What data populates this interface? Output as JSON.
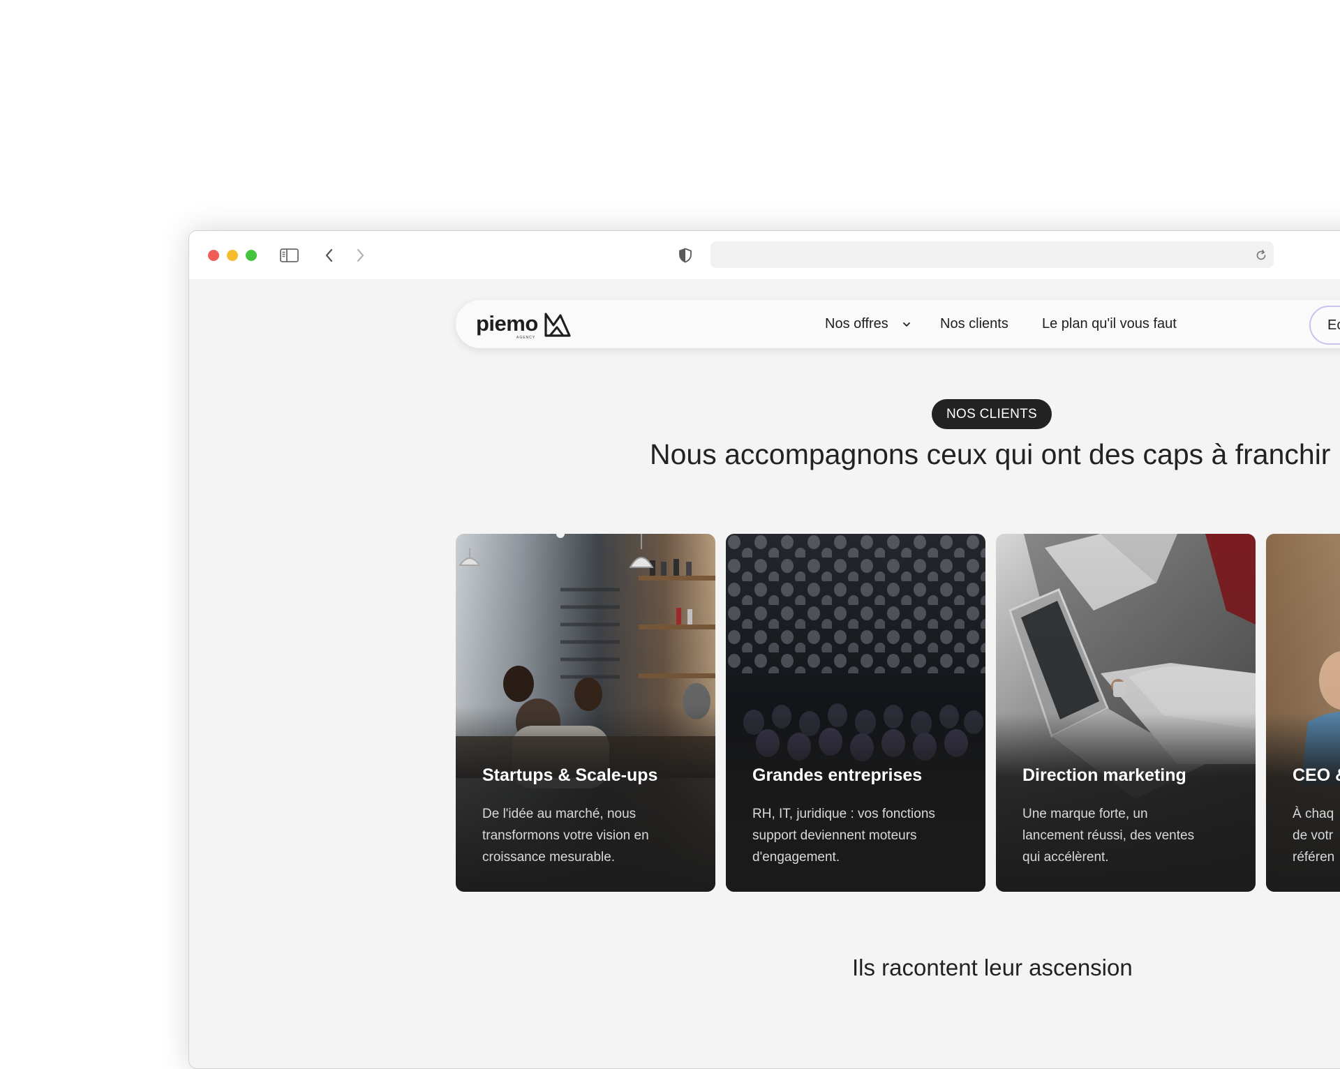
{
  "browser": {
    "address_value": ""
  },
  "nav": {
    "logo_text": "piemo",
    "logo_sub": "AGENCY",
    "links": [
      "Nos offres",
      "Nos clients",
      "Le plan qu'il vous faut"
    ],
    "cta_label": "Ec"
  },
  "hero": {
    "badge": "NOS CLIENTS",
    "headline": "Nous accompagnons ceux qui ont des caps à franchir"
  },
  "cards": [
    {
      "title": "Startups & Scale-ups",
      "desc_lines": [
        "De l'idée au marché, nous",
        "transformons votre vision en",
        "croissance mesurable."
      ]
    },
    {
      "title": "Grandes entreprises",
      "desc_lines": [
        "RH, IT, juridique : vos fonctions",
        "support deviennent moteurs",
        "d'engagement."
      ]
    },
    {
      "title": "Direction marketing",
      "desc_lines": [
        "Une marque forte, un",
        "lancement réussi, des ventes",
        "qui accélèrent."
      ]
    },
    {
      "title": "CEO &",
      "desc_lines": [
        "À chaq",
        "de votr",
        "référen"
      ]
    }
  ],
  "section2": {
    "title": "Ils racontent leur ascension"
  },
  "colors": {
    "badge_bg": "#222222",
    "cta_border": "#cdc0ee",
    "page_bg": "#f4f4f4"
  }
}
